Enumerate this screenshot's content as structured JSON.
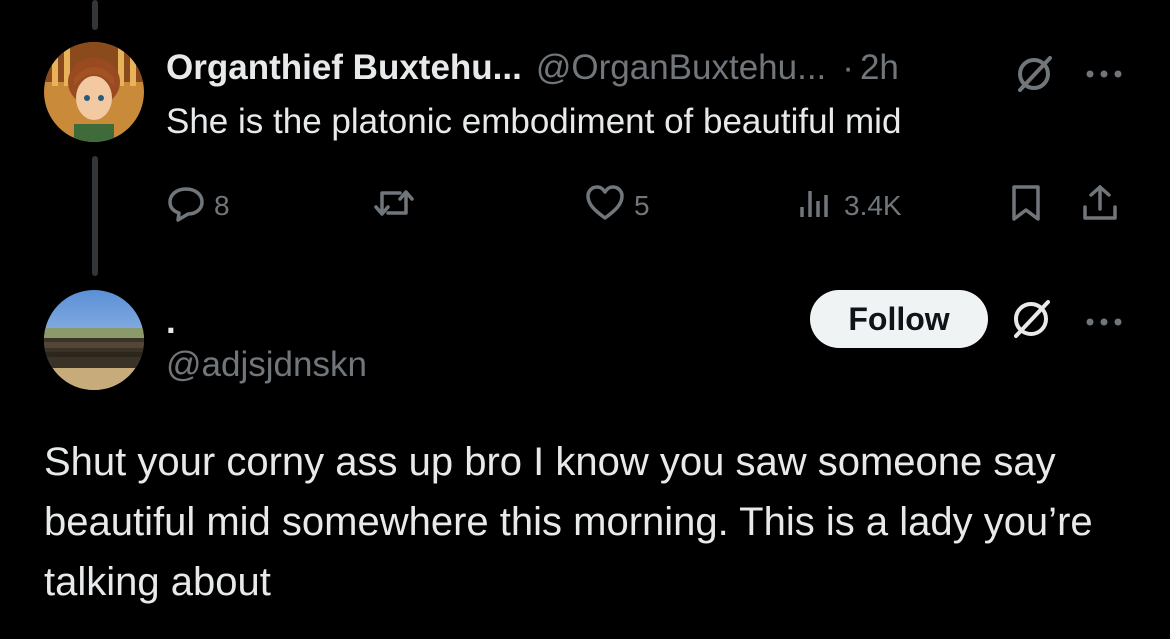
{
  "colors": {
    "background": "#000000",
    "primary_text": "#e7e9ea",
    "secondary_text": "#71767b",
    "follow_button_bg": "#eff3f4"
  },
  "tweet1": {
    "display_name": "Organthief Buxtehu...",
    "handle": "@OrganBuxtehu...",
    "separator": "·",
    "time": "2h",
    "text": "She is the platonic embodiment of beautiful mid",
    "actions": {
      "replies": "8",
      "likes": "5",
      "views": "3.4K"
    },
    "icons": [
      "grok-icon",
      "more-icon",
      "reply-icon",
      "retweet-icon",
      "like-icon",
      "views-icon",
      "bookmark-icon",
      "share-icon"
    ]
  },
  "tweet2": {
    "display_name": ".",
    "handle": "@adjsjdnskn",
    "follow_label": "Follow",
    "text": "Shut your corny ass up bro I know you saw someone say beautiful mid somewhere this morning. This is a lady you’re talking about"
  }
}
